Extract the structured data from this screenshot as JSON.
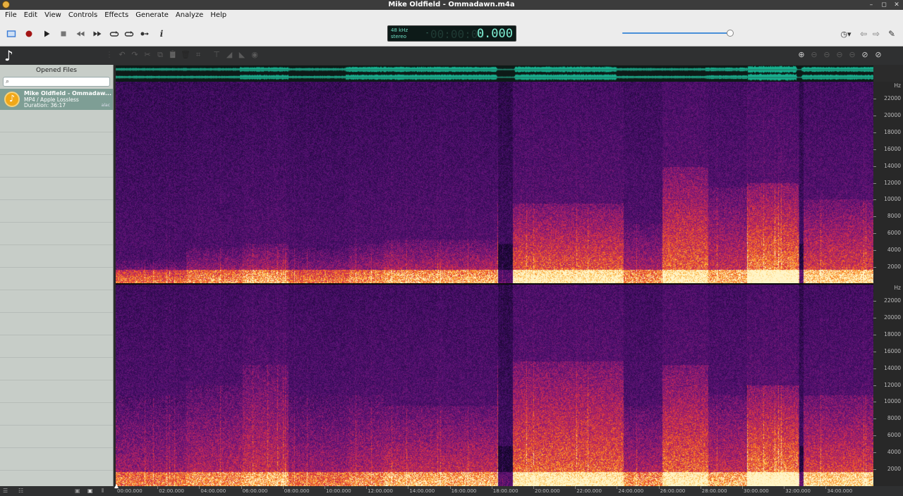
{
  "window": {
    "title": "Mike Oldfield - Ommadawn.m4a",
    "controls": [
      "–",
      "◻",
      "✕"
    ]
  },
  "menu": [
    "File",
    "Edit",
    "View",
    "Controls",
    "Effects",
    "Generate",
    "Analyze",
    "Help"
  ],
  "toolbar": {
    "buttons": [
      {
        "name": "view-toggle-icon",
        "glyph": "▭"
      },
      {
        "name": "record-icon",
        "glyph": "●"
      },
      {
        "name": "play-icon",
        "glyph": "▶"
      },
      {
        "name": "stop-icon",
        "glyph": "■"
      },
      {
        "name": "rewind-icon",
        "glyph": "◀◀"
      },
      {
        "name": "fast-forward-icon",
        "glyph": "▶▶"
      },
      {
        "name": "loop-icon",
        "glyph": "⟲"
      },
      {
        "name": "repeat-icon",
        "glyph": "⟳"
      },
      {
        "name": "follow-playback-icon",
        "glyph": "●→"
      },
      {
        "name": "info-icon",
        "glyph": "i"
      }
    ],
    "lcd": {
      "sample_rate": "48 kHz",
      "channels": "stereo",
      "sign": "-",
      "ghost_digits": "00:00:00",
      "time": "0.000"
    },
    "volume_level": 1.0,
    "right_buttons": [
      {
        "name": "history-icon",
        "glyph": "◷▾"
      },
      {
        "name": "back-icon",
        "glyph": "⇦"
      },
      {
        "name": "forward-icon",
        "glyph": "⇨"
      },
      {
        "name": "settings-icon",
        "glyph": "✎"
      }
    ]
  },
  "viewbar": {
    "note_glyph": "♪",
    "edit_buttons": [
      {
        "name": "undo-icon",
        "glyph": "↶"
      },
      {
        "name": "redo-icon",
        "glyph": "↷"
      },
      {
        "name": "cut-icon",
        "glyph": "✂"
      },
      {
        "name": "copy-icon",
        "glyph": "⧉"
      },
      {
        "name": "paste-icon",
        "glyph": "📋"
      },
      {
        "name": "delete-icon",
        "glyph": "🗑"
      },
      {
        "name": "crop-icon",
        "glyph": "⌗"
      },
      {
        "name": "normalize-icon",
        "glyph": "⊤"
      },
      {
        "name": "fade-in-icon",
        "glyph": "◢"
      },
      {
        "name": "fade-out-icon",
        "glyph": "◣"
      },
      {
        "name": "spectrum-icon",
        "glyph": "◉"
      }
    ],
    "zoom_buttons": [
      {
        "name": "zoom-in-icon",
        "glyph": "⊕"
      },
      {
        "name": "zoom-out-icon",
        "glyph": "⊖"
      },
      {
        "name": "zoom-fit-icon",
        "glyph": "⊖"
      },
      {
        "name": "zoom-selection-icon",
        "glyph": "⊖"
      },
      {
        "name": "zoom-reset-icon",
        "glyph": "⊖"
      },
      {
        "name": "vertical-zoom-in-icon",
        "glyph": "⊘"
      },
      {
        "name": "vertical-zoom-out-icon",
        "glyph": "⊘"
      }
    ]
  },
  "sidebar": {
    "title": "Opened Files",
    "search_placeholder": "",
    "files": [
      {
        "name": "Mike Oldfield - Ommadaw...",
        "format": "MP4 / Apple Lossless",
        "duration": "Duration: 36:17",
        "badge": "alac"
      }
    ]
  },
  "frequency_axis": {
    "unit": "Hz",
    "labels": [
      "22000",
      "20000",
      "18000",
      "16000",
      "14000",
      "12000",
      "10000",
      "8000",
      "6000",
      "4000",
      "2000"
    ]
  },
  "time_axis": {
    "labels": [
      "00:00.000",
      "02:00.000",
      "04:00.000",
      "06:00.000",
      "08:00.000",
      "10:00.000",
      "12:00.000",
      "14:00.000",
      "16:00.000",
      "18:00.000",
      "20:00.000",
      "22:00.000",
      "24:00.000",
      "26:00.000",
      "28:00.000",
      "30:00.000",
      "32:00.000",
      "34:00.000"
    ]
  },
  "colors": {
    "spectrogram_low": "#2a0a45",
    "spectrogram_mid": "#8b1a6e",
    "spectrogram_high": "#ff6a1a",
    "spectrogram_peak": "#fff0b0",
    "waveform": "#17b08f"
  }
}
